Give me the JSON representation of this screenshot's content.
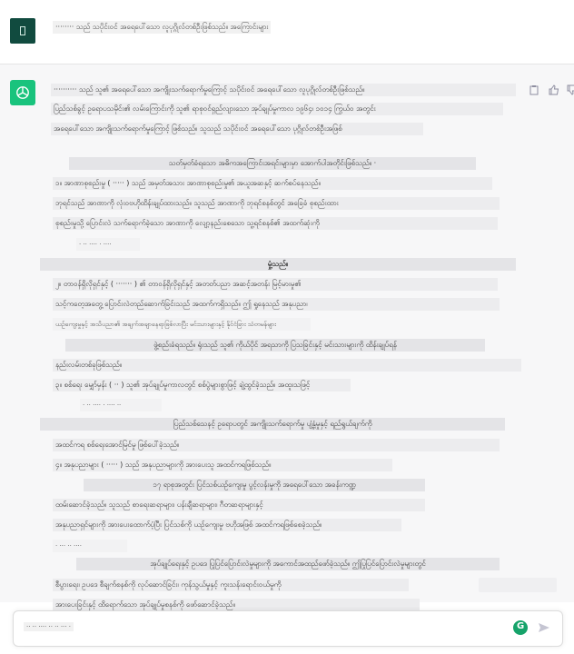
{
  "user_message": {
    "text": "········ သည် သပိုင်းဝင် အရေပေါ်သော လူပုဂ္ဂိုလ်တစ်ဦးဖြစ်သည်။ အကြောင်းများ"
  },
  "assistant_message": {
    "lines": [
      {
        "text": "·········· သည် သူ၏ အရေပေါ်သော အကျိုးသက်ရောက်မှုကြောင့် သပိုင်းဝင် အရေပေါ်သော လူပုဂ္ဂိုလ်တစ်ဦးဖြစ်သည်။"
      },
      {
        "text": "ပြည်သစ်ခွင့် ဥရောပသမိုင်း၏ လမ်းကြောင်းကို သူ၏ ရာစုဝင်ရှည်လျားသော အုပ်ချုပ်မှုကာလ ၁၉၆၄၊ ၁၀၁၄ ကြွယ်ဝ အတွင်း"
      },
      {
        "text": "အရေပေါ်သော အကျိုးသက်ရောက်မှုကြောင့် ဖြစ်သည်။ သူသည် သပိုင်းဝင် အရေပေါ်သော ပုဂ္ဂိုလ်တစ်ဦးအဖြစ်"
      },
      {
        "text": "သတ်မှတ်ခံရသော အဓိကအကြောင်းအရင်းများမှာ အောက်ပါအတိုင်းဖြစ်သည်။ ·"
      },
      {
        "text": "၁။ အာဏာစုစည်းမှု ( ····· ) သည် အမှတ်အသား အာဏာစုစည်းမှု၏ အယူအဆနှင့် ဆက်စပ်နေသည်။"
      },
      {
        "text": "ဘုရင်သည် အာဏာကို လုံးဝဗဟိုထိန်းချုပ်ထားသည်။ သူသည် အာဏာကို ဘုရင်စနစ်တွင် အခြေခံ စုစည်းထား"
      },
      {
        "text": "စုစည်းမှုသို့ ပြောင်းလဲ သက်ရောက်ခဲ့သော အာဏာကို လျော့နည်းစေသော သူ့ရင်စနစ်၏ အထက်ဆုံးကို"
      },
      {
        "text": "· ·· ···· · ····"
      },
      {
        "text": "မှုံ့သည်။"
      },
      {
        "text": "၂။ တာဝန်ရှိလိုရှင်နှင့် ( ······· ) ၏ တာဝန်ရှိလိုရှင်နှင့် အတတ်ပညာ အဆင့်အတန်း မြင့်မားမှု၏"
      },
      {
        "text": "သင့်ကတေ့အတွေ့ ပြောင်းလဲတည်ဆောက်ခြင်းသည် အထက်ကရှိသည်။ ဤ ရှုနေသည် အနုပညာ၊"
      },
      {
        "text": "ယဉ်ကျေးမှုနှင့် အသိပညာ၏ အချက်အချာနေရာဖြစ်လာပြီး မင်းသားများနှင့် နိုင်ငံခြား သံတမန်များ"
      },
      {
        "text": "ဖွဲ့စည်းခံရသည်။ ရုံးသည် သူ၏ ကိုယ်ပိုင် အရသာကို ပြသခြင်းနှင့် မင်းသားများကို ထိန်းချုပ်ရန်"
      },
      {
        "text": "နည်းလမ်းတစ်ခုဖြစ်သည်။"
      },
      {
        "text": "၃။ စစ်ရေး မျှော်မှန်း ( ·· ) သူ၏ အုပ်ချုပ်မှုကာလတွင် စစ်ပွဲများစွာဖြင့် ချဲ့ထွင်ခဲ့သည်။ အထူးသဖြင့်"
      },
      {
        "text": "· ·· ···· · ···· ··"
      },
      {
        "text": "ပြည်သစ်သေနင့် ဥရောပတွင် အကျိုးသက်ရောက်မှု ပျံ့နှံ့မှုနှင့် ရည်ရွယ်ချက်ကို"
      },
      {
        "text": "အထင်ကရ စစ်ရေးအောင်မြင်မှု ဖြစ်ပေါ်ခဲ့သည်။"
      },
      {
        "text": "၄။ အနုပညာများ ( ····· ) သည် အနုပညာများကို အားပေးသူ အထင်ကရဖြစ်သည်။"
      },
      {
        "text": "၁၇ ရာစုအတွင်း ပြင်သစ်ယဉ်ကျေးမှု ပွင့်လန်းမှုကို အရေပေါ်သော အခန်းကဏ္ဍ"
      },
      {
        "text": "ထမ်းဆောင်ခဲ့သည်။ သူသည် စာရေးဆရာများ၊ ပန်းချီဆရာများ၊ ဂီတဆရာများနှင့်"
      },
      {
        "text": "အနုပညာရှင်များကို အားပေးထောက်ပံ့ပြီး ပြင်သစ်ကို ယဉ်ကျေးမှု ဗဟိုအဖြစ် အထင်ကရဖြစ်စေခဲ့သည်။"
      },
      {
        "text": "· ··· ·· ····"
      },
      {
        "text": "အုပ်ချုပ်ရေးနှင့် ဥပဒေ ပြုပြင်ပြောင်းလဲမှုများကို အကောင်အထည်ဖော်ခဲ့သည်။ ဤပြုပြင်ပြောင်းလဲမှုများတွင်"
      },
      {
        "text": "စီပွားရေး၊ ဥပဒေ စီချက်စနစ်ကို လုပ်ဆောင်ခြင်း၊ ကုန်သွယ်မှုနှင့် ကူးသန်းရောင်းဝယ်မှုကို"
      },
      {
        "text": "အားပေးခြင်းနှင့် ထိရောက်သော အုပ်ချုပ်မှုစနစ်ကို ဖော်ဆောင်ခဲ့သည်။"
      }
    ],
    "action_icons": [
      "clipboard-icon",
      "thumbs-up-icon",
      "thumbs-down-icon"
    ]
  },
  "composer": {
    "input_value": "·· ·· ···· ·· ·· ··· ·",
    "grammarly_letter": "G",
    "send_icon": "send-icon"
  },
  "colors": {
    "user_avatar": "#114b3f",
    "bot_avatar": "#19c37d",
    "assistant_background": "#f7f7f8"
  }
}
